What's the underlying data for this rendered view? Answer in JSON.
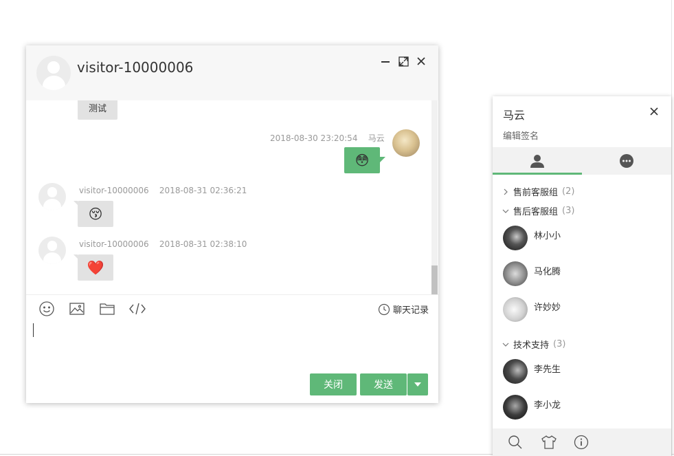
{
  "chat": {
    "title": "visitor-10000006",
    "messages": [
      {
        "side": "left",
        "text": "测试"
      },
      {
        "side": "right",
        "time": "2018-08-30 23:20:54",
        "author": "马云",
        "emoji": "😳"
      },
      {
        "side": "left",
        "author": "visitor-10000006",
        "time": "2018-08-31 02:36:21",
        "emoji": "😚"
      },
      {
        "side": "left",
        "author": "visitor-10000006",
        "time": "2018-08-31 02:38:10",
        "emoji": "❤️"
      }
    ],
    "toolbar": {
      "icons": [
        "smile-icon",
        "image-icon",
        "folder-icon",
        "code-icon"
      ],
      "history_label": "聊天记录"
    },
    "buttons": {
      "close_label": "关闭",
      "send_label": "发送"
    }
  },
  "panel": {
    "name": "马云",
    "signature": "编辑签名",
    "tabs": [
      "friends-icon",
      "chat-bubble-icon"
    ],
    "groups": [
      {
        "label": "售前客服组",
        "count": "(2)"
      },
      {
        "label": "售后客服组",
        "count": "(3)",
        "friends": [
          "林小小",
          "马化腾",
          "许妙妙"
        ]
      },
      {
        "label": "技术支持",
        "count": "(3)",
        "friends": [
          "李先生",
          "李小龙"
        ]
      }
    ],
    "footer_icons": [
      "search-icon",
      "skin-icon",
      "info-icon"
    ]
  },
  "colors": {
    "accent": "#5fb878",
    "bubble": "#e2e2e2"
  }
}
